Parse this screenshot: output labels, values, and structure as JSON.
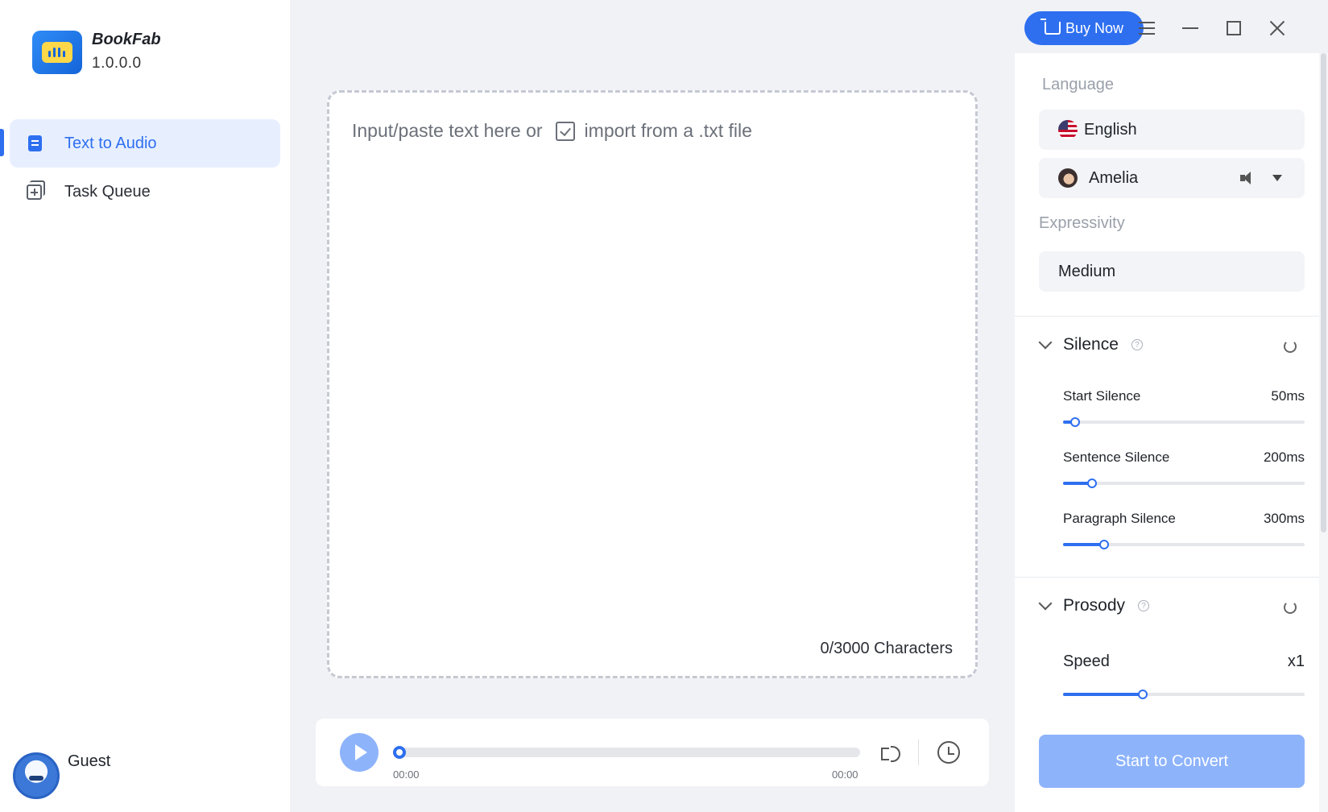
{
  "app": {
    "name": "BookFab",
    "version": "1.0.0.0"
  },
  "sidebar": {
    "items": [
      {
        "label": "Text to Audio",
        "icon": "document-icon",
        "active": true
      },
      {
        "label": "Task Queue",
        "icon": "queue-icon",
        "active": false
      }
    ],
    "user": {
      "name": "Guest"
    }
  },
  "titlebar": {
    "buy_label": "Buy Now"
  },
  "editor": {
    "placeholder": "Input/paste text here or",
    "import_label": "import from a .txt file",
    "char_count": "0/3000 Characters"
  },
  "player": {
    "current_time": "00:00",
    "total_time": "00:00",
    "progress": 0
  },
  "settings": {
    "language_title": "Language",
    "language_value": "English",
    "voice_value": "Amelia",
    "expressivity_title": "Expressivity",
    "expressivity_value": "Medium",
    "silence": {
      "title": "Silence",
      "start": {
        "label": "Start Silence",
        "value": "50ms",
        "fraction": 0.05
      },
      "sentence": {
        "label": "Sentence Silence",
        "value": "200ms",
        "fraction": 0.12
      },
      "paragraph": {
        "label": "Paragraph Silence",
        "value": "300ms",
        "fraction": 0.17
      }
    },
    "prosody": {
      "title": "Prosody",
      "speed": {
        "label": "Speed",
        "value": "x1",
        "fraction": 0.33
      }
    },
    "convert_label": "Start to Convert"
  },
  "colors": {
    "accent": "#2e6ff0",
    "accent_light": "#8db3fb",
    "active_bg": "#e7efff"
  }
}
